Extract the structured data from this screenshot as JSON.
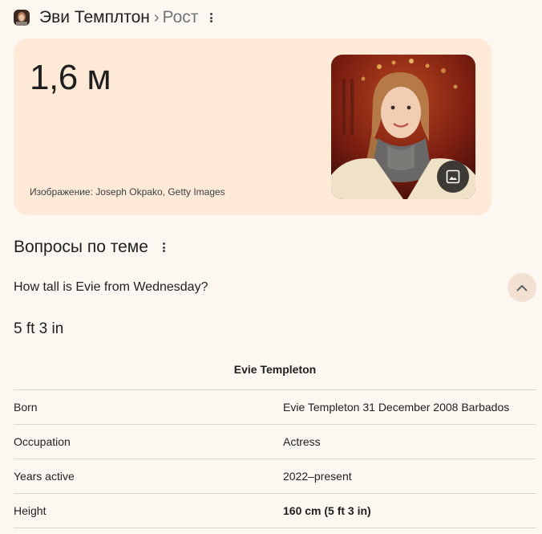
{
  "header": {
    "title": "Эви Темплтон",
    "separator": "›",
    "subtitle": "Рост"
  },
  "card": {
    "value": "1,6 м",
    "credit": "Изображение: Joseph Okpako, Getty Images"
  },
  "related": {
    "title": "Вопросы по теме",
    "question": "How tall is Evie from Wednesday?",
    "answer": "5 ft 3 in"
  },
  "table": {
    "title": "Evie Templeton",
    "rows": [
      {
        "label": "Born",
        "value": "Evie Templeton 31 December 2008 Barbados"
      },
      {
        "label": "Occupation",
        "value": "Actress"
      },
      {
        "label": "Years active",
        "value": "2022–present"
      },
      {
        "label": "Height",
        "value": "160 cm (5 ft 3 in)"
      }
    ]
  },
  "icons": {
    "header_menu": "more-vert-icon",
    "image_button": "image-icon",
    "collapse": "chevron-up-icon"
  },
  "colors": {
    "page_bg": "#fdf7f2",
    "card_bg": "#feead6",
    "chevron_bg": "#f2e1d2"
  }
}
